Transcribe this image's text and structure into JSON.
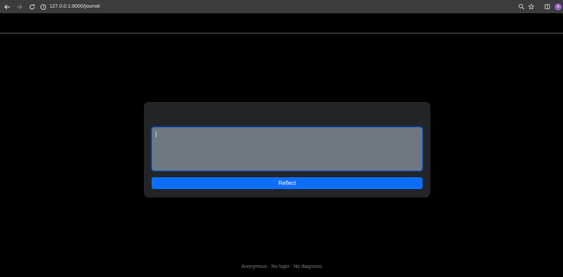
{
  "browser": {
    "url": "127.0.0.1:8000/journal",
    "avatar_letter": "A",
    "icons": [
      "back-arrow-icon",
      "forward-arrow-icon",
      "reload-icon",
      "site-info-icon",
      "zoom-icon",
      "bookmark-star-icon",
      "extensions-icon",
      "profile-avatar"
    ]
  },
  "journal": {
    "input_value": "",
    "submit_label": "Reflect"
  },
  "footer": {
    "text": "Anonymous · No login · No diagnosis"
  },
  "colors": {
    "background": "#000000",
    "card": "#222428",
    "input": "#6f7780",
    "accent": "#0d6efd"
  }
}
